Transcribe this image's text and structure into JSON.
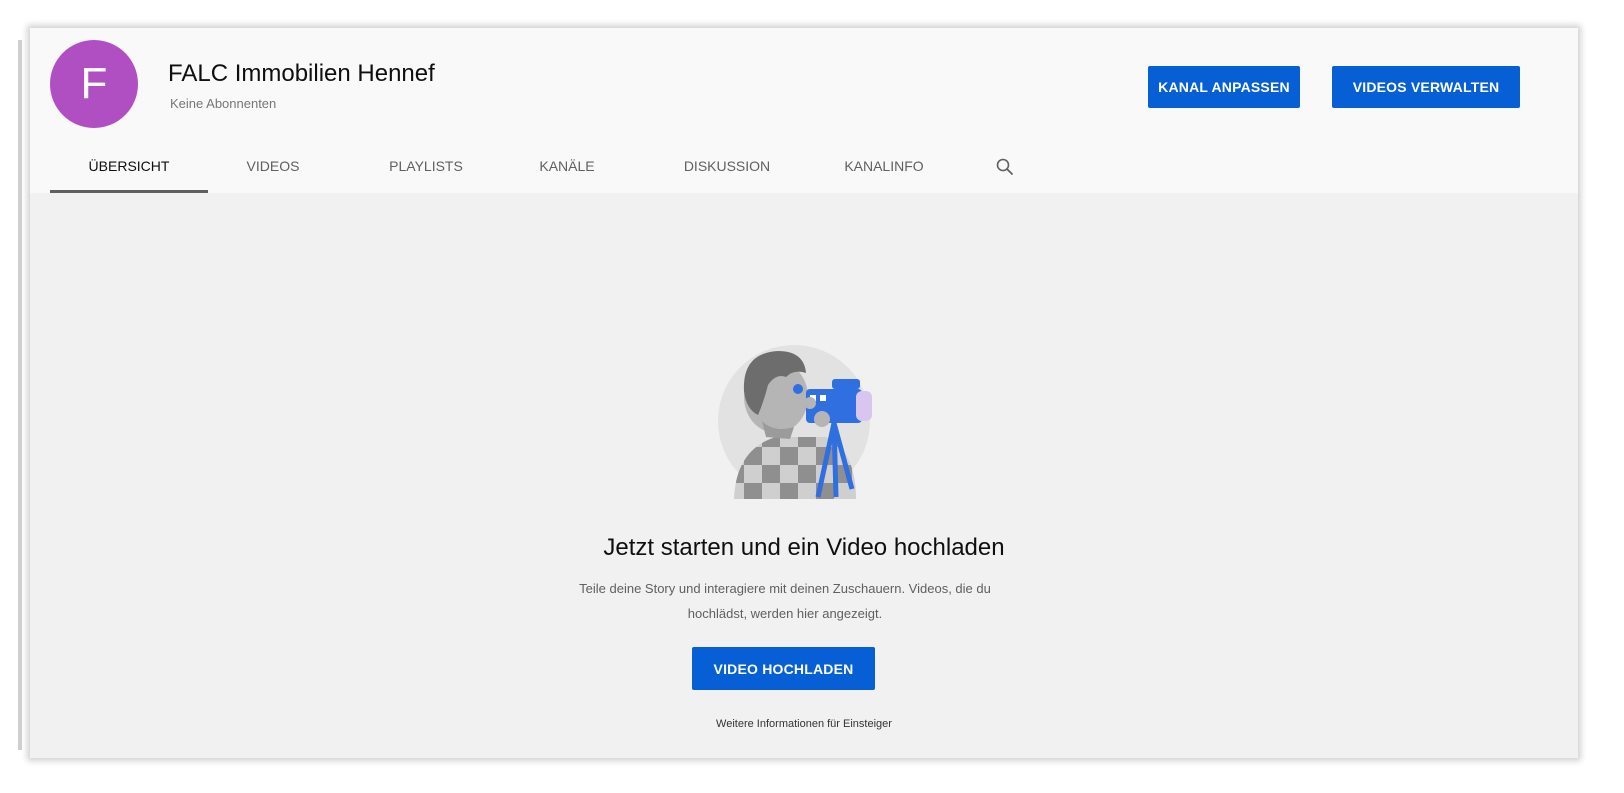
{
  "channel": {
    "initial": "F",
    "name": "FALC Immobilien Hennef",
    "subscribers": "Keine Abonnenten",
    "avatar_color": "#b04fc2"
  },
  "header_buttons": {
    "customize": "KANAL ANPASSEN",
    "manage": "VIDEOS VERWALTEN"
  },
  "tabs": [
    {
      "label": "ÜBERSICHT",
      "active": true
    },
    {
      "label": "VIDEOS",
      "active": false
    },
    {
      "label": "PLAYLISTS",
      "active": false
    },
    {
      "label": "KANÄLE",
      "active": false
    },
    {
      "label": "DISKUSSION",
      "active": false
    },
    {
      "label": "KANALINFO",
      "active": false
    }
  ],
  "tab_search_icon": "search-icon",
  "empty_state": {
    "title": "Jetzt starten und ein Video hochladen",
    "description_line1": "Teile deine Story und interagiere mit deinen Zuschauern. Videos, die du",
    "description_line2": "hochlädst, werden hier angezeigt.",
    "upload_button": "VIDEO HOCHLADEN",
    "learn_more": "Weitere Informationen für Einsteiger",
    "illustration": "camera-person-illustration"
  },
  "colors": {
    "accent": "#065fd4",
    "page_background": "#f1f1f1",
    "header_background": "#f9f9f9"
  }
}
